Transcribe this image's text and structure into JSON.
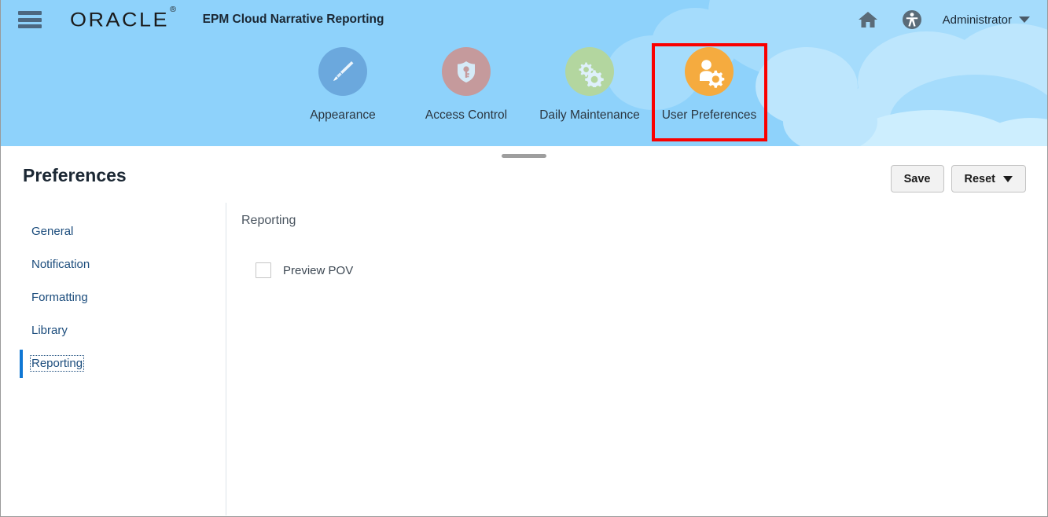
{
  "header": {
    "menu_icon": "hamburger-menu-icon",
    "brand": "ORACLE",
    "brand_mark": "®",
    "app_title": "EPM Cloud Narrative Reporting",
    "home_icon": "home-icon",
    "accessibility_icon": "accessibility-icon",
    "user_name": "Administrator",
    "background_color": "#8ed2fb"
  },
  "cards": [
    {
      "label": "Appearance",
      "icon": "paintbrush-icon",
      "color": "#6ba8dd",
      "selected": false
    },
    {
      "label": "Access Control",
      "icon": "shield-key-icon",
      "color": "#c59a9c",
      "selected": false
    },
    {
      "label": "Daily Maintenance",
      "icon": "gears-icon",
      "color": "#b3d69f",
      "selected": false
    },
    {
      "label": "User Preferences",
      "icon": "user-gear-icon",
      "color": "#f5ab3f",
      "selected": true
    }
  ],
  "highlight_color": "#fa0000",
  "page": {
    "title": "Preferences",
    "save_label": "Save",
    "reset_label": "Reset"
  },
  "sidebar": {
    "items": [
      {
        "label": "General",
        "active": false
      },
      {
        "label": "Notification",
        "active": false
      },
      {
        "label": "Formatting",
        "active": false
      },
      {
        "label": "Library",
        "active": false
      },
      {
        "label": "Reporting",
        "active": true
      }
    ]
  },
  "main": {
    "section_title": "Reporting",
    "options": [
      {
        "label": "Preview POV",
        "checked": false
      }
    ]
  }
}
